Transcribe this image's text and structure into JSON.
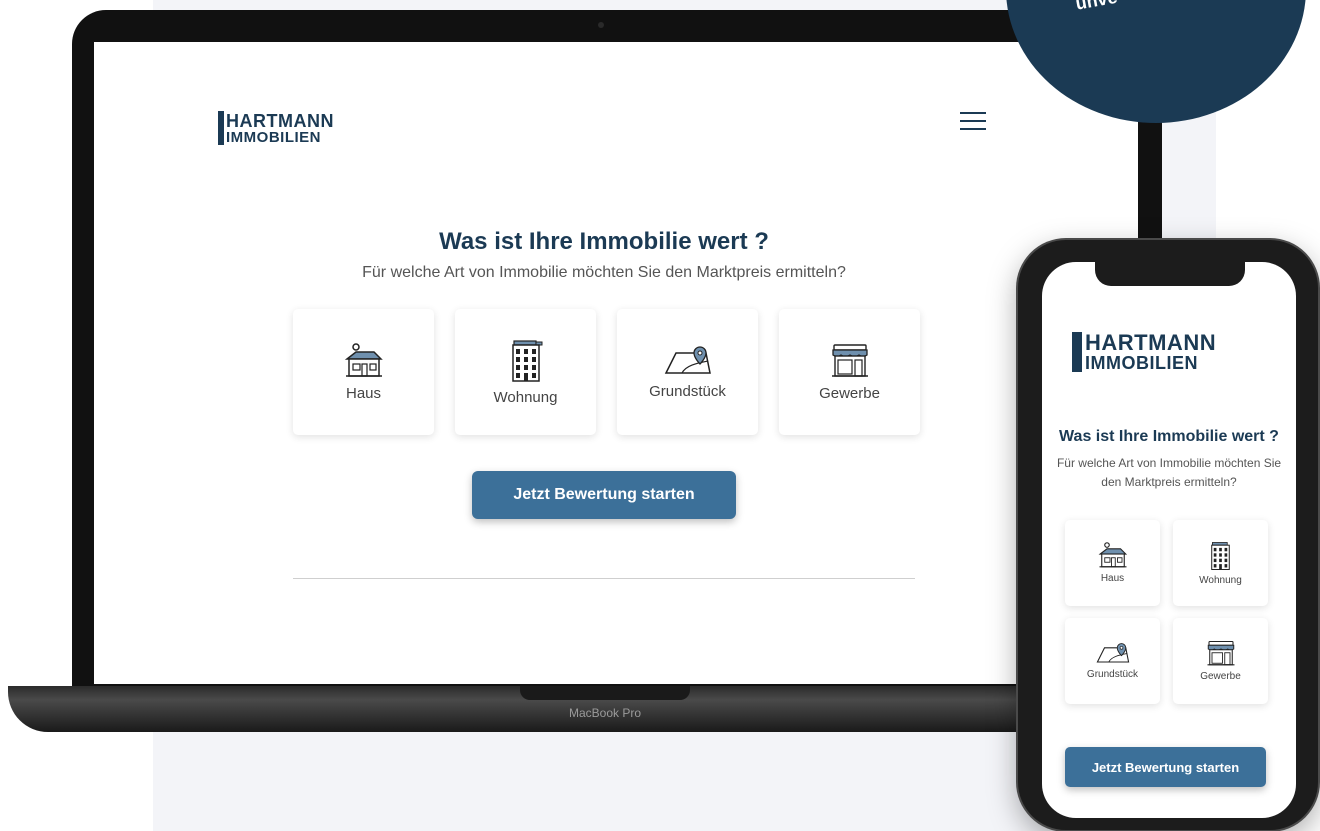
{
  "brand": {
    "line1": "HARTMANN",
    "line2": "IMMOBILIEN",
    "primary_color": "#1b3a54",
    "button_color": "#3c7099"
  },
  "badge": {
    "text": "unve"
  },
  "laptop": {
    "label": "MacBook Pro"
  },
  "desktop": {
    "title": "Was ist Ihre Immobilie wert ?",
    "subtitle": "Für welche Art von Immobilie möchten Sie den Marktpreis ermitteln?",
    "cards": [
      {
        "label": "Haus",
        "icon": "house-icon"
      },
      {
        "label": "Wohnung",
        "icon": "apartment-building-icon"
      },
      {
        "label": "Grundstück",
        "icon": "land-plot-pin-icon"
      },
      {
        "label": "Gewerbe",
        "icon": "storefront-icon"
      }
    ],
    "cta": "Jetzt Bewertung starten"
  },
  "mobile": {
    "title": "Was ist Ihre Immobilie wert ?",
    "subtitle": "Für welche Art von Immobilie möchten Sie den Marktpreis ermitteln?",
    "cards": [
      {
        "label": "Haus",
        "icon": "house-icon"
      },
      {
        "label": "Wohnung",
        "icon": "apartment-building-icon"
      },
      {
        "label": "Grundstück",
        "icon": "land-plot-pin-icon"
      },
      {
        "label": "Gewerbe",
        "icon": "storefront-icon"
      }
    ],
    "cta": "Jetzt Bewertung starten"
  }
}
